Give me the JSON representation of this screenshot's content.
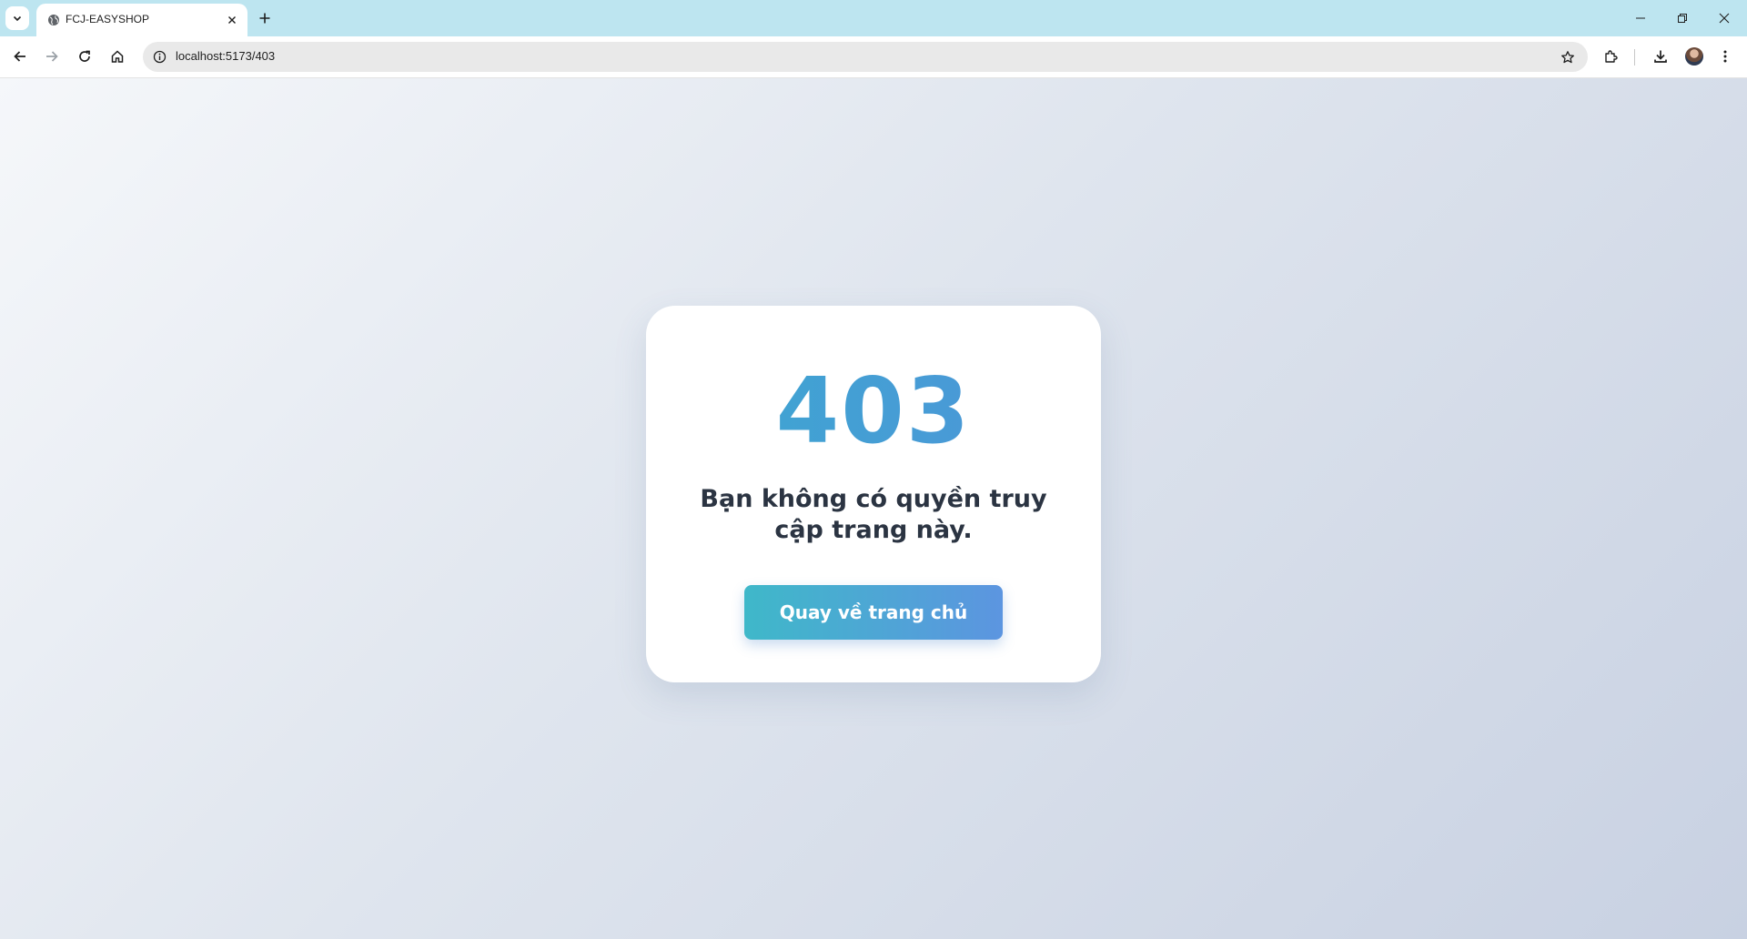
{
  "browser": {
    "tab": {
      "title": "FCJ-EASYSHOP",
      "favicon": "globe-icon"
    },
    "address_bar": {
      "url": "localhost:5173/403"
    },
    "colors": {
      "tabstrip": "#bde5f0",
      "toolbar": "#ffffff",
      "omnibox": "#e9e9e9"
    }
  },
  "page": {
    "error_code": "403",
    "message": "Bạn không có quyền truy cập trang này.",
    "home_button_label": "Quay về trang chủ",
    "colors": {
      "code_gradient": [
        "#3ba8d0",
        "#4f94d9"
      ],
      "button_gradient": [
        "#3fb8c9",
        "#5c95e0"
      ],
      "message": "#2b3442",
      "background_gradient": [
        "#f5f7fa",
        "#c8d1e2"
      ]
    }
  }
}
